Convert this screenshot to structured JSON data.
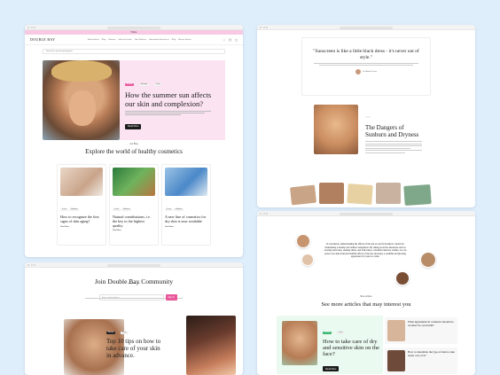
{
  "window1": {
    "top_banner": "Home",
    "logo": "DOUBLE BAY",
    "nav": [
      "Natural Ideas",
      "Blog",
      "Nutrition",
      "Self-care Guide",
      "Vibe Wellness",
      "Educational Resources",
      "Blog",
      "Wellness",
      "Moving Stories"
    ],
    "search_placeholder": "Search for articles by keyword",
    "hero": {
      "tags": [
        "Beauty",
        "Nutrition",
        "3 min"
      ],
      "title": "How the summer sun affects our skin and complexion?",
      "button": "Read More"
    },
    "section_kicker": "Our Blog",
    "section_title": "Explore the world of healthy cosmetics",
    "cards": [
      {
        "tags": [
          "5 min",
          "Nutrition"
        ],
        "title": "How to recognize the first signs of skin aging?",
        "read": "Read More"
      },
      {
        "tags": [
          "5 min",
          "Nutrition"
        ],
        "title": "Natural contributions, i.e. the key to the highest quality",
        "read": "Read More"
      },
      {
        "tags": [
          "5 min",
          "Nutrition"
        ],
        "title": "A new line of cosmetics for dry skin is now available",
        "read": "Read More"
      }
    ]
  },
  "window2": {
    "quote": "\"Sunscreen is like a little black dress - it's never out of style.\"",
    "quote_author": "Dr. Amelia Davis",
    "section_title": "The Dangers of Sunburn and Dryness"
  },
  "window3": {
    "title": "Join Double Bay Community",
    "input_placeholder": "Enter email address",
    "button": "Sign In",
    "article": {
      "tags": [
        "Beauty",
        "3 min"
      ],
      "title": "Top 10 tips on how to take care of your skin in advance."
    }
  },
  "window4": {
    "conclusion": "In conclusion, understanding the effects of the sun on our facial skin is crucial for maintaining a healthy and radiant complexion. By taking proactive measures such as wearing sunscreen, seeking shade, and following a consistent skincare routine, we can protect our skin from the harmful effects of the sun and enjoy a youthful and glowing appearance for years to come.",
    "kicker": "More articles",
    "section_title": "See more articles that may interest you",
    "featured": {
      "tags": [
        "Beauty",
        "3 min"
      ],
      "title": "How to take care of dry and sensitive skin on the face?",
      "button": "Read More"
    },
    "side": [
      {
        "title": "What ingredients in cosmetics should be avoided for our health?"
      },
      {
        "title": "How to determine the type of skin to take better care of it?"
      }
    ]
  },
  "colors": {
    "background": "#dfeefb",
    "hero_pink": "#fbe3f2",
    "accent_pink": "#e8589a",
    "accent_green": "#3bb673",
    "mint": "#eafaf0"
  }
}
